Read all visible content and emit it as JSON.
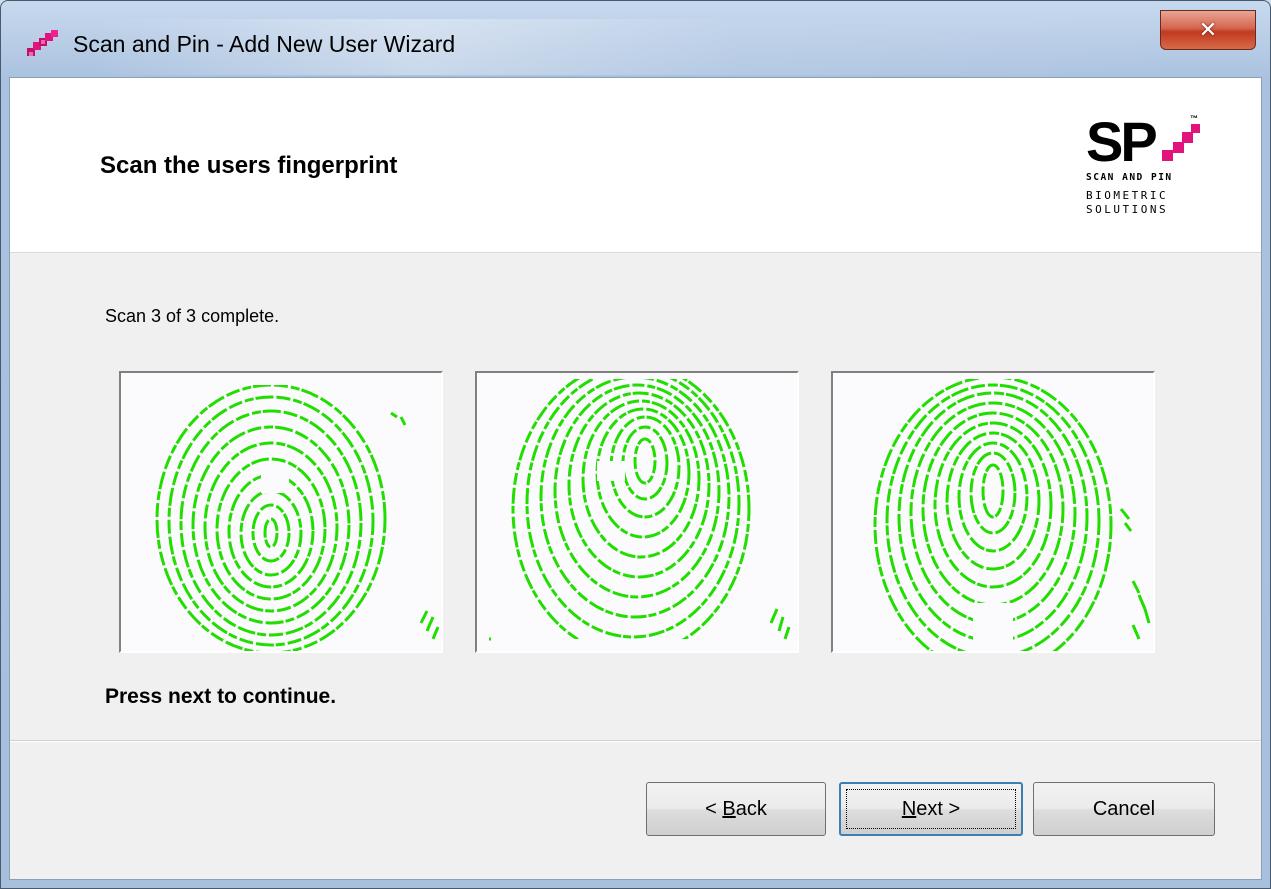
{
  "window": {
    "title": "Scan and Pin - Add New User Wizard",
    "app_icon": "scan-and-pin-app-icon",
    "close_icon": "close-x-icon"
  },
  "header": {
    "title": "Scan the users fingerprint",
    "logo": {
      "mark": "SP",
      "tm": "™",
      "line1": "SCAN AND PIN",
      "line2": "BIOMETRIC",
      "line3": "SOLUTIONS",
      "accent_color": "#e0147c"
    }
  },
  "body": {
    "status": "Scan 3 of 3 complete.",
    "scans": [
      {
        "label": "scan-1",
        "color": "#22dd00"
      },
      {
        "label": "scan-2",
        "color": "#22dd00"
      },
      {
        "label": "scan-3",
        "color": "#22dd00"
      }
    ],
    "instruction": "Press next to continue."
  },
  "footer": {
    "back": {
      "pre": "< ",
      "mnemonic": "B",
      "post": "ack"
    },
    "next": {
      "mnemonic": "N",
      "post": "ext >"
    },
    "cancel": "Cancel"
  }
}
